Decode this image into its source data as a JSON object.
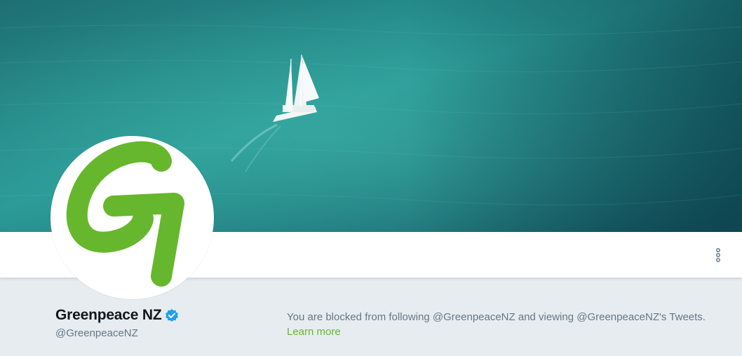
{
  "profile": {
    "name": "Greenpeace NZ",
    "handle": "@GreenpeaceNZ",
    "verified": true
  },
  "notice": {
    "blocked_text": "You are blocked from following @GreenpeaceNZ and viewing @GreenpeaceNZ's Tweets.",
    "learn_more_label": "Learn more"
  },
  "icons": {
    "more": "more-vertical-icon",
    "verified": "verified-badge-icon"
  },
  "colors": {
    "background": "#e6ecf0",
    "sea": "#2f9a95",
    "brand_green": "#66b72d",
    "verified_blue": "#1da1f2",
    "link_green": "#66b72d"
  }
}
